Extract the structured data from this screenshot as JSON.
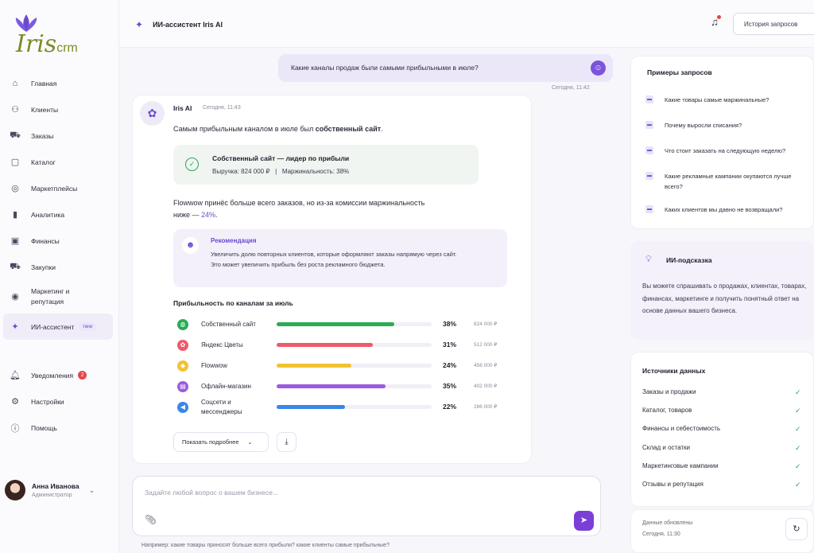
{
  "brand": {
    "logo_text": "Iris",
    "logo_sub": "crm"
  },
  "sidebar": {
    "items": [
      {
        "label": "Главная",
        "icon": "home-icon",
        "glyph": "⌂"
      },
      {
        "label": "Клиенты",
        "icon": "users-icon",
        "glyph": "☺"
      },
      {
        "label": "Заказы",
        "icon": "cart-icon",
        "glyph": "🛒"
      },
      {
        "label": "Каталог",
        "icon": "box-icon",
        "glyph": "▢"
      },
      {
        "label": "Маркетплейсы",
        "icon": "store-icon",
        "glyph": "◎"
      },
      {
        "label": "Аналитика",
        "icon": "chart-icon",
        "glyph": "▮"
      },
      {
        "label": "Финансы",
        "icon": "wallet-icon",
        "glyph": "▣"
      },
      {
        "label": "Закупки",
        "icon": "basket-icon",
        "glyph": "🛒"
      }
    ],
    "marketing_label_1": "Маркетинг и",
    "marketing_label_2": "репутация",
    "ai_label": "ИИ-ассистент",
    "ai_badge": "new",
    "notifications_label": "Уведомления",
    "notifications_count": "2",
    "settings_label": "Настройки",
    "help_label": "Помощь"
  },
  "profile": {
    "name": "Анна Иванова",
    "role": "Администратор"
  },
  "header": {
    "title": "ИИ-ассистент Iris AI",
    "history_button": "История запросов"
  },
  "chat": {
    "user_message": "Какие каналы продаж были самыми прибыльными в июле?",
    "user_time": "Сегодня, 11:42",
    "ai_name": "Iris AI",
    "ai_time": "Сегодня, 11:43",
    "answer_prefix": "Самым прибыльным каналом в июле был ",
    "answer_bold": "собственный сайт",
    "answer_suffix": ".",
    "highlight_title": "Собственный сайт — лидер по прибыли",
    "highlight_sub": "Выручка: 824 000 ₽   |   Маржинальность: 38%",
    "para2_text": "Flowwow принёс больше всего заказов, но из-за комиссии маржинальность ниже — ",
    "para2_accent": "24%",
    "para2_end": ".",
    "rec_title": "Рекомендация",
    "rec_text": "Увеличить долю повторных клиентов, которые оформляют заказы напрямую через сайт. Это может увеличить прибыль без роста рекламного бюджета.",
    "chart_title": "Прибыльность по каналам за июль",
    "more_button": "Показать подробнее"
  },
  "chart_data": {
    "type": "bar",
    "title": "Прибыльность по каналам за июль",
    "categories": [
      "Собственный сайт",
      "Яндекс Цветы",
      "Flowwow",
      "Офлайн-магазин",
      "Соцсети и мессенджеры"
    ],
    "values": [
      38,
      31,
      24,
      35,
      22
    ],
    "amounts": [
      "824 000 ₽",
      "512 000 ₽",
      "456 000 ₽",
      "402 000 ₽",
      "286 000 ₽"
    ],
    "colors": [
      "#2bab55",
      "#ee5a6a",
      "#f1c232",
      "#9b5ce0",
      "#3a86e8"
    ],
    "icons": [
      "globe-icon",
      "flower-icon",
      "bag-icon",
      "shop-icon",
      "megaphone-icon"
    ],
    "xlim": [
      0,
      50
    ]
  },
  "input": {
    "placeholder": "Задайте любой вопрос о вашем бизнесе...",
    "hint": "Например: какие товары приносят больше всего прибыли? какие клиенты самые прибыльные?"
  },
  "examples": {
    "title": "Примеры запросов",
    "items": [
      "Какие товары самые маржинальные?",
      "Почему выросли списания?",
      "Что стоит заказать на следующую неделю?",
      "Какие рекламные кампании окупаются лучше всего?",
      "Каких клиентов мы давно не возвращали?"
    ]
  },
  "tip": {
    "title": "ИИ-подсказка",
    "text": "Вы можете спрашивать о продажах, клиентах, товарах, финансах, маркетинге и получить понятный ответ на основе данных вашего бизнеса."
  },
  "sources": {
    "title": "Источники данных",
    "items": [
      "Заказы и продажи",
      "Каталог, товаров",
      "Финансы и себестоимость",
      "Склад и остатки",
      "Маркетинговые кампании",
      "Отзывы и репутация"
    ]
  },
  "updated": {
    "label": "Данные обновлены",
    "time": "Сегодня, 11:30"
  }
}
